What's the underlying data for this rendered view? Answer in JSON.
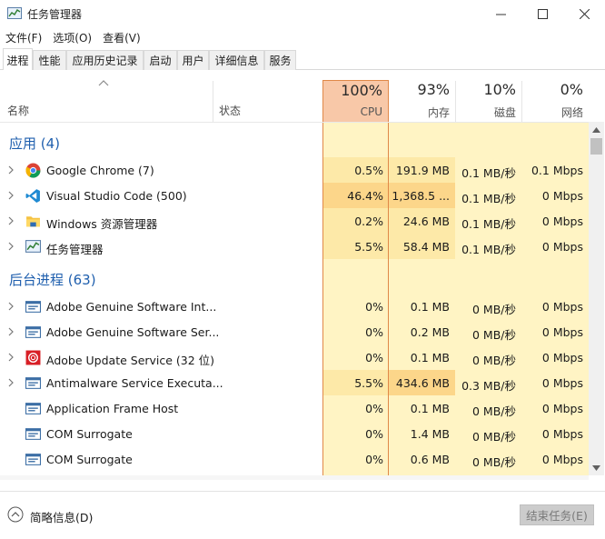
{
  "window": {
    "title": "任务管理器",
    "controls": {
      "minimize": "—",
      "maximize": "☐",
      "close": "✕"
    }
  },
  "menu": [
    "文件(F)",
    "选项(O)",
    "查看(V)"
  ],
  "tabs": [
    "进程",
    "性能",
    "应用历史记录",
    "启动",
    "用户",
    "详细信息",
    "服务"
  ],
  "active_tab": "进程",
  "columns": {
    "name": "名称",
    "status": "状态",
    "metrics": [
      {
        "key": "cpu",
        "percent": "100%",
        "label": "CPU"
      },
      {
        "key": "mem",
        "percent": "93%",
        "label": "内存"
      },
      {
        "key": "disk",
        "percent": "10%",
        "label": "磁盘"
      },
      {
        "key": "net",
        "percent": "0%",
        "label": "网络"
      }
    ]
  },
  "groups": [
    {
      "title": "应用 (4)",
      "rows": [
        {
          "name": "Google Chrome (7)",
          "icon": "chrome-icon",
          "expandable": true,
          "cpu": "0.5%",
          "mem": "191.9 MB",
          "disk": "0.1 MB/秒",
          "net": "0.1 Mbps"
        },
        {
          "name": "Visual Studio Code (500)",
          "icon": "vscode-icon",
          "expandable": true,
          "cpu": "46.4%",
          "mem": "1,368.5 ...",
          "disk": "0.1 MB/秒",
          "net": "0 Mbps"
        },
        {
          "name": "Windows 资源管理器",
          "icon": "folder-icon",
          "expandable": true,
          "cpu": "0.2%",
          "mem": "24.6 MB",
          "disk": "0.1 MB/秒",
          "net": "0 Mbps"
        },
        {
          "name": "任务管理器",
          "icon": "task-manager-icon",
          "expandable": true,
          "cpu": "5.5%",
          "mem": "58.4 MB",
          "disk": "0.1 MB/秒",
          "net": "0 Mbps"
        }
      ]
    },
    {
      "title": "后台进程 (63)",
      "rows": [
        {
          "name": "Adobe Genuine Software Int...",
          "icon": "service-icon",
          "expandable": true,
          "cpu": "0%",
          "mem": "0.1 MB",
          "disk": "0 MB/秒",
          "net": "0 Mbps"
        },
        {
          "name": "Adobe Genuine Software Ser...",
          "icon": "service-icon",
          "expandable": true,
          "cpu": "0%",
          "mem": "0.2 MB",
          "disk": "0 MB/秒",
          "net": "0 Mbps"
        },
        {
          "name": "Adobe Update Service (32 位)",
          "icon": "adobe-icon",
          "expandable": true,
          "cpu": "0%",
          "mem": "0.1 MB",
          "disk": "0 MB/秒",
          "net": "0 Mbps"
        },
        {
          "name": "Antimalware Service Executa...",
          "icon": "service-icon",
          "expandable": true,
          "cpu": "5.5%",
          "mem": "434.6 MB",
          "disk": "0.3 MB/秒",
          "net": "0 Mbps"
        },
        {
          "name": "Application Frame Host",
          "icon": "service-icon",
          "expandable": false,
          "cpu": "0%",
          "mem": "0.1 MB",
          "disk": "0 MB/秒",
          "net": "0 Mbps"
        },
        {
          "name": "COM Surrogate",
          "icon": "service-icon",
          "expandable": false,
          "cpu": "0%",
          "mem": "1.4 MB",
          "disk": "0 MB/秒",
          "net": "0 Mbps"
        },
        {
          "name": "COM Surrogate",
          "icon": "service-icon",
          "expandable": false,
          "cpu": "0%",
          "mem": "0.6 MB",
          "disk": "0 MB/秒",
          "net": "0 Mbps"
        }
      ]
    }
  ],
  "footer": {
    "fewer_details": "简略信息(D)",
    "end_task": "结束任务(E)"
  },
  "colors": {
    "group_title": "#1f5fae",
    "cpu_high": "#fcd68a",
    "cpu_mid": "#fde9a8",
    "cell_light": "#fff4c4",
    "cpu_header": "#f8c8a8",
    "cpu_border": "#e08848"
  }
}
